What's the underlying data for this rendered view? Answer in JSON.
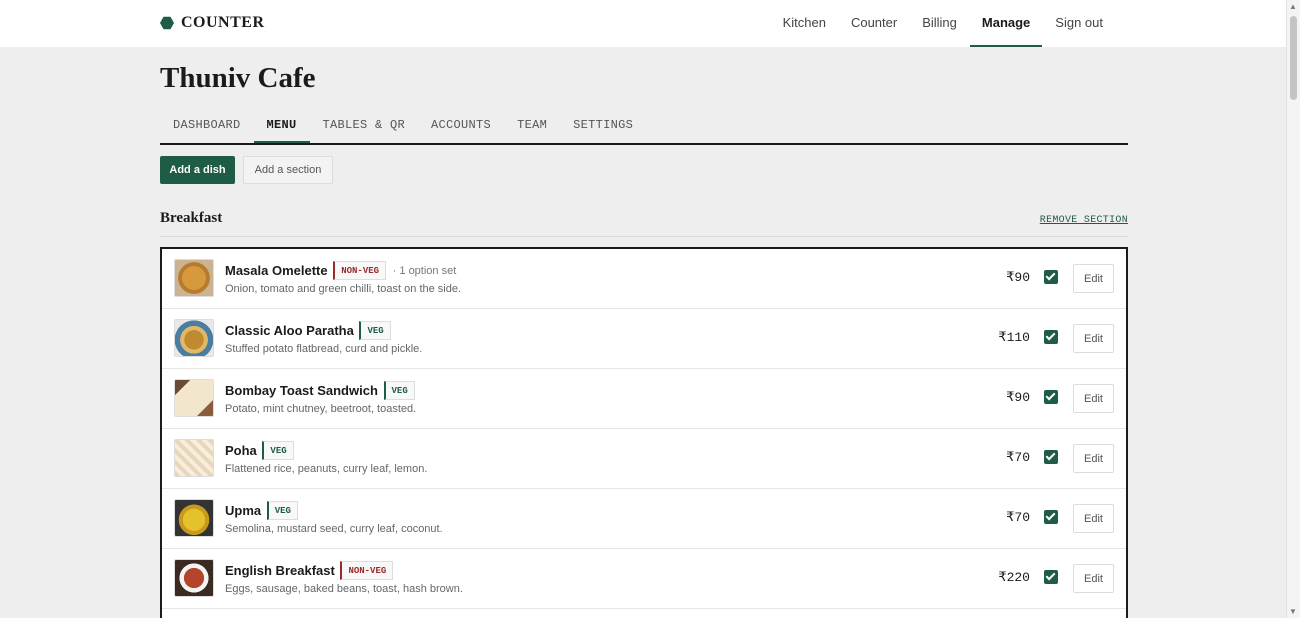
{
  "brand": {
    "name": "COUNTER",
    "icon": "hexagon-logo-icon",
    "accent": "#1f5c45"
  },
  "nav": {
    "items": [
      "Kitchen",
      "Counter",
      "Billing",
      "Manage",
      "Sign out"
    ],
    "active": "Manage"
  },
  "page": {
    "title": "Thuniv Cafe"
  },
  "tabs": {
    "items": [
      "DASHBOARD",
      "MENU",
      "TABLES & QR",
      "ACCOUNTS",
      "TEAM",
      "SETTINGS"
    ],
    "active": "MENU"
  },
  "actions": {
    "add_dish": "Add a dish",
    "add_section": "Add a section"
  },
  "section": {
    "title": "Breakfast",
    "remove_label": "REMOVE SECTION"
  },
  "dishes": [
    {
      "name": "Masala Omelette",
      "tag": "NON-VEG",
      "options": "· 1 option set",
      "description": "Onion, tomato and green chilli, toast on the side.",
      "price": "₹90",
      "available": true,
      "edit_label": "Edit"
    },
    {
      "name": "Classic Aloo Paratha",
      "tag": "VEG",
      "options": "",
      "description": "Stuffed potato flatbread, curd and pickle.",
      "price": "₹110",
      "available": true,
      "edit_label": "Edit"
    },
    {
      "name": "Bombay Toast Sandwich",
      "tag": "VEG",
      "options": "",
      "description": "Potato, mint chutney, beetroot, toasted.",
      "price": "₹90",
      "available": true,
      "edit_label": "Edit"
    },
    {
      "name": "Poha",
      "tag": "VEG",
      "options": "",
      "description": "Flattened rice, peanuts, curry leaf, lemon.",
      "price": "₹70",
      "available": true,
      "edit_label": "Edit"
    },
    {
      "name": "Upma",
      "tag": "VEG",
      "options": "",
      "description": "Semolina, mustard seed, curry leaf, coconut.",
      "price": "₹70",
      "available": true,
      "edit_label": "Edit"
    },
    {
      "name": "English Breakfast",
      "tag": "NON-VEG",
      "options": "",
      "description": "Eggs, sausage, baked beans, toast, hash brown.",
      "price": "₹220",
      "available": true,
      "edit_label": "Edit"
    }
  ]
}
